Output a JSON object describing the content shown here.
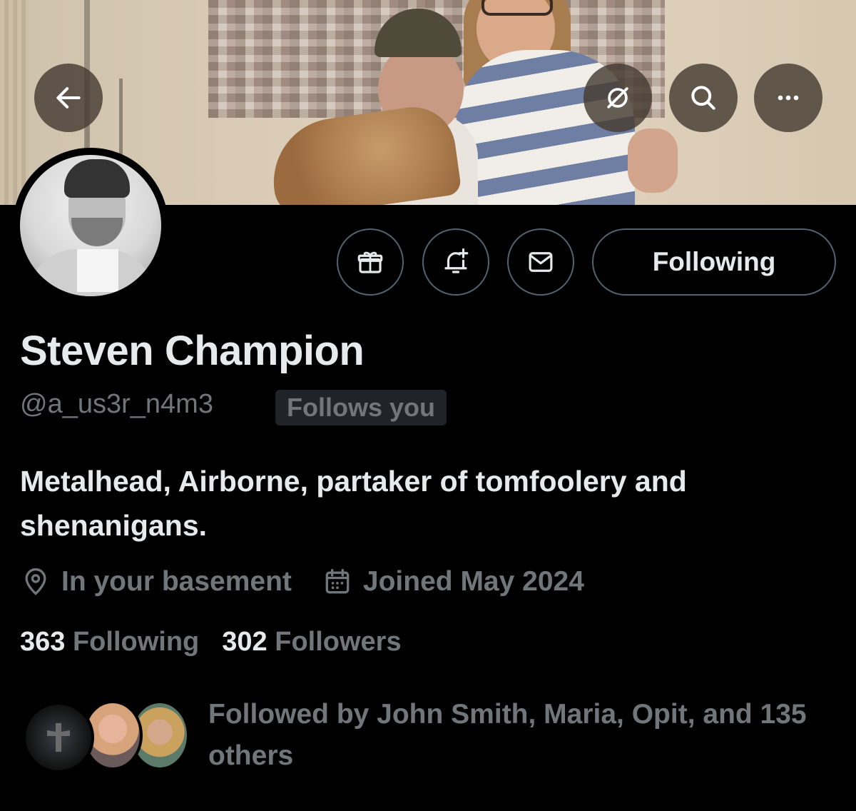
{
  "header": {
    "banner_alt": "",
    "icons": [
      "back-arrow-icon",
      "grok-icon",
      "search-icon",
      "more-icon"
    ]
  },
  "profile": {
    "name": "Steven Champion",
    "handle": "@a_us3r_n4m3",
    "follows_you": "Follows you",
    "bio": "Metalhead, Airborne, partaker of tomfoolery and shenanigans.",
    "location": "In your basement",
    "joined": "Joined May 2024"
  },
  "actions": {
    "follow_label": "Following",
    "icons": [
      "gift-icon",
      "bell-plus-icon",
      "mail-icon"
    ]
  },
  "stats": {
    "following_count": "363",
    "following_label": "Following",
    "followers_count": "302",
    "followers_label": "Followers"
  },
  "followed_by": {
    "text": "Followed by John Smith, Maria, Opit, and 135 others"
  },
  "colors": {
    "background": "#000000",
    "primary_text": "#e7e9ea",
    "secondary_text": "#71767b",
    "border": "#536471",
    "badge_bg": "#202327"
  }
}
